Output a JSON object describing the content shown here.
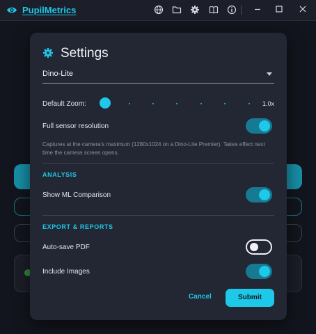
{
  "app": {
    "title": "PupilMetrics"
  },
  "titlebar": {
    "icons": [
      "globe-icon",
      "folder-icon",
      "gear-icon",
      "book-icon",
      "info-icon"
    ],
    "window_controls": [
      "minimize-icon",
      "maximize-icon",
      "close-icon"
    ]
  },
  "dialog": {
    "title": "Settings",
    "camera_select": {
      "value": "Dino-Lite"
    },
    "default_zoom": {
      "label": "Default Zoom:",
      "value": "1.0x",
      "level": 0
    },
    "full_sensor": {
      "label": "Full sensor resolution",
      "enabled": true,
      "helper": "Captures at the camera's maximum (1280x1024 on a Dino-Lite Premier). Takes effect next time the camera screen opens."
    },
    "analysis": {
      "heading": "ANALYSIS",
      "show_ml": {
        "label": "Show ML Comparison",
        "enabled": true
      }
    },
    "export": {
      "heading": "EXPORT & REPORTS",
      "auto_save_pdf": {
        "label": "Auto-save PDF",
        "enabled": false
      },
      "include_images": {
        "label": "Include Images",
        "enabled": true
      }
    },
    "cancel_label": "Cancel",
    "submit_label": "Submit"
  },
  "colors": {
    "accent": "#1ec8e8",
    "dialog_bg": "#232633",
    "app_bg": "#12151d"
  }
}
